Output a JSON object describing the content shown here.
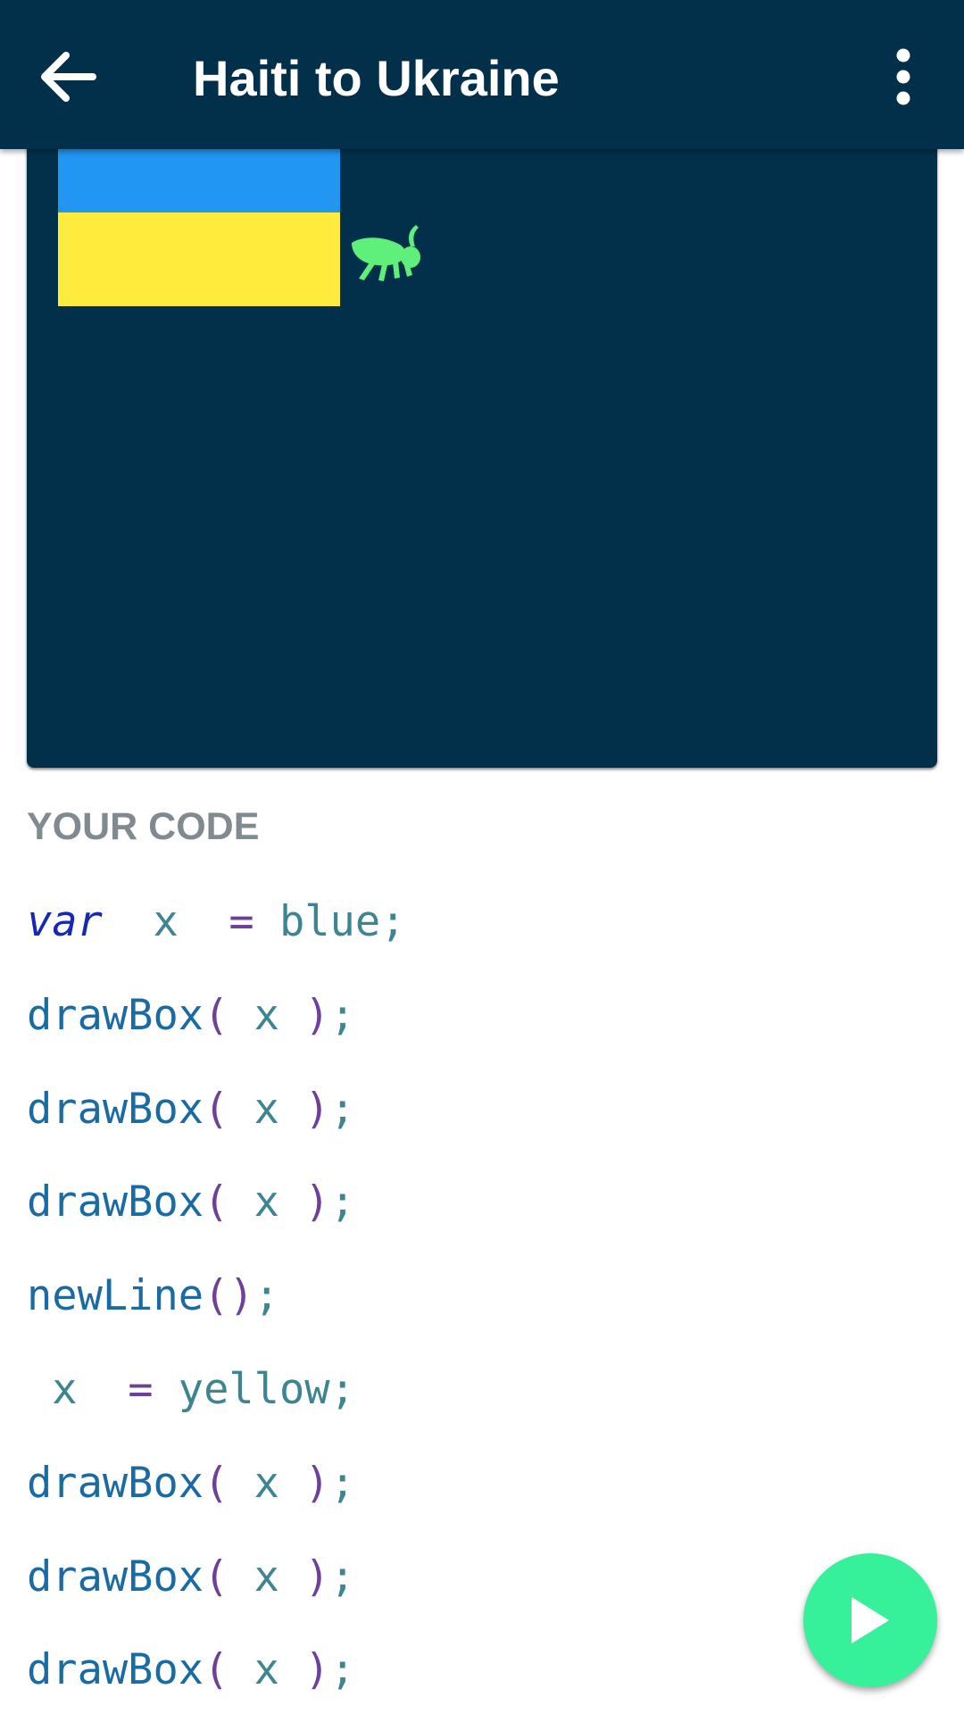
{
  "appbar": {
    "title": "Haiti to Ukraine",
    "back_icon": "arrow-back-icon",
    "menu_icon": "more-vertical-icon"
  },
  "canvas": {
    "background": "#02304a",
    "flag_colors": {
      "top": "#2196f3",
      "bottom": "#ffeb3b"
    },
    "mascot_icon": "grasshopper-icon",
    "mascot_color": "#5ef07a"
  },
  "code_section": {
    "label": "YOUR CODE",
    "lines": [
      {
        "kw": "var",
        "var": "x",
        "op": "=",
        "value": "blue",
        "end": ";"
      },
      {
        "fn": "drawBox",
        "open": "(",
        "arg": "x",
        "close": ")",
        "end": ";"
      },
      {
        "fn": "drawBox",
        "open": "(",
        "arg": "x",
        "close": ")",
        "end": ";"
      },
      {
        "fn": "drawBox",
        "open": "(",
        "arg": "x",
        "close": ")",
        "end": ";"
      },
      {
        "fn": "newLine",
        "open": "(",
        "arg": "",
        "close": ")",
        "end": ";"
      },
      {
        "var": "x",
        "op": "=",
        "value": "yellow",
        "end": ";"
      },
      {
        "fn": "drawBox",
        "open": "(",
        "arg": "x",
        "close": ")",
        "end": ";"
      },
      {
        "fn": "drawBox",
        "open": "(",
        "arg": "x",
        "close": ")",
        "end": ";"
      },
      {
        "fn": "drawBox",
        "open": "(",
        "arg": "x",
        "close": ")",
        "end": ";"
      }
    ]
  },
  "run_button": {
    "icon": "play-icon",
    "color": "#37f09a"
  }
}
